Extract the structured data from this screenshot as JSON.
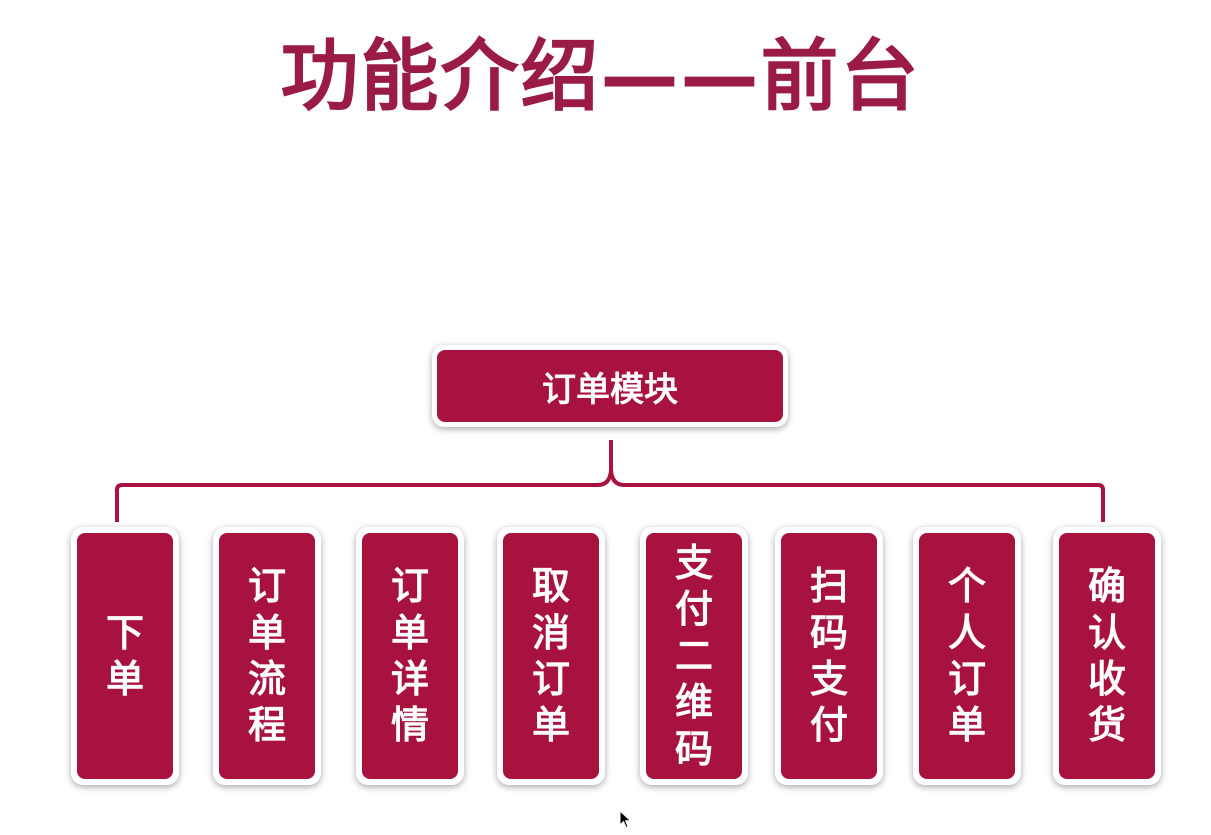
{
  "title": "功能介绍——前台",
  "root": {
    "label": "订单模块"
  },
  "children": [
    {
      "label": "下单"
    },
    {
      "label": "订单流程"
    },
    {
      "label": "订单详情"
    },
    {
      "label": "取消订单"
    },
    {
      "label": "支付二维码"
    },
    {
      "label": "扫码支付"
    },
    {
      "label": "个人订单"
    },
    {
      "label": "确认收货"
    }
  ],
  "colors": {
    "accent": "#a8123e",
    "title": "#9b1b47",
    "connector": "#a8123e"
  }
}
